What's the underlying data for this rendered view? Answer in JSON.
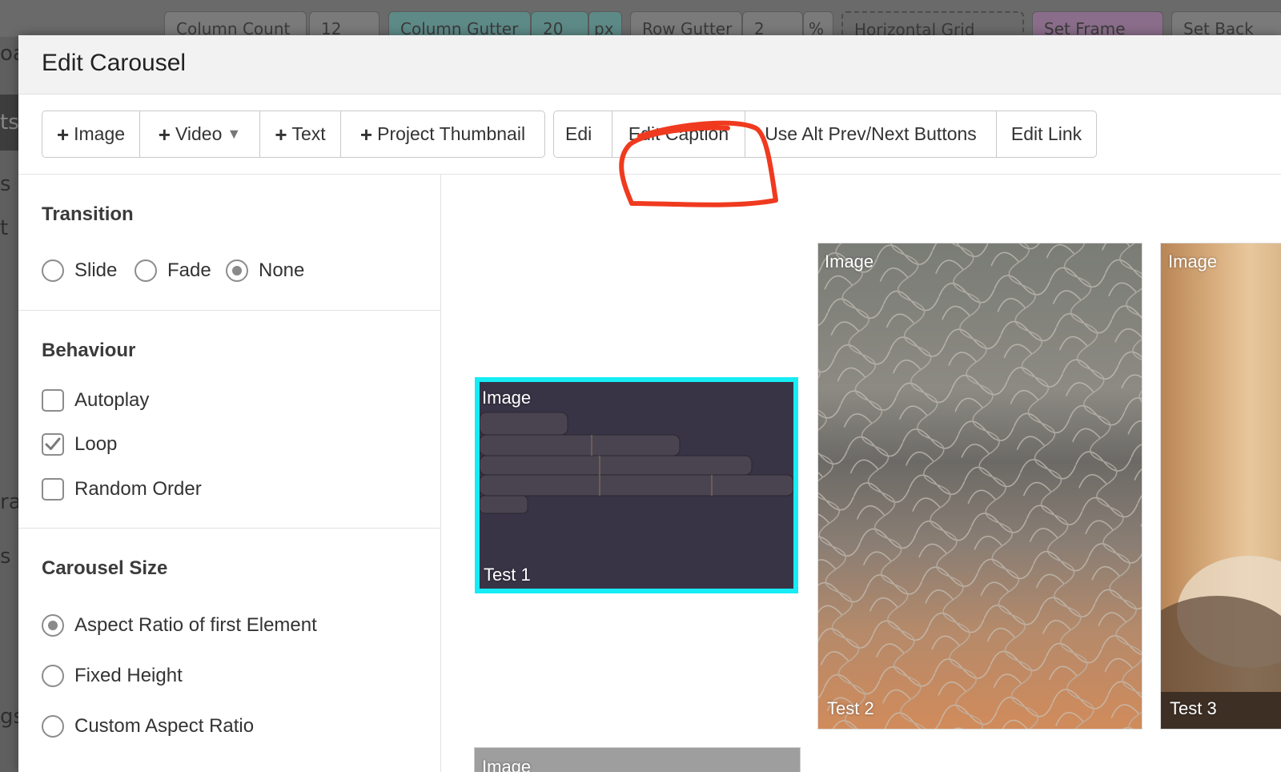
{
  "background": {
    "controls": [
      "Column Count",
      "12",
      "Column Gutter",
      "20",
      "px",
      "Row Gutter",
      "2",
      "%",
      "Horizontal Grid",
      "Set Frame",
      "Set Back"
    ],
    "left_fragments": [
      "oa",
      "ts",
      "s",
      "t",
      "ra",
      "s",
      "gs"
    ]
  },
  "modal": {
    "title": "Edit Carousel",
    "toolbar": {
      "add_group": [
        {
          "name": "add-image",
          "label": "Image",
          "plus": "+"
        },
        {
          "name": "add-video",
          "label": "Video",
          "plus": "+",
          "caret": "▼"
        },
        {
          "name": "add-text",
          "label": "Text",
          "plus": "+"
        },
        {
          "name": "add-project-thumbnail",
          "label": "Project Thumbnail",
          "plus": "+"
        }
      ],
      "edit_group": [
        {
          "name": "edit-truncated",
          "label": "Edi"
        },
        {
          "name": "edit-caption",
          "label": "Edit Caption"
        },
        {
          "name": "use-alt-prev-next",
          "label": "Use Alt Prev/Next Buttons"
        },
        {
          "name": "edit-link",
          "label": "Edit Link"
        }
      ]
    },
    "annotation_color": "#f03a1f",
    "selected_color": "#16ecf4",
    "left": {
      "transition": {
        "title": "Transition",
        "options": [
          {
            "label": "Slide",
            "checked": false
          },
          {
            "label": "Fade",
            "checked": false
          },
          {
            "label": "None",
            "checked": true
          }
        ]
      },
      "behaviour": {
        "title": "Behaviour",
        "options": [
          {
            "label": "Autoplay",
            "checked": false
          },
          {
            "label": "Loop",
            "checked": true
          },
          {
            "label": "Random Order",
            "checked": false
          }
        ]
      },
      "size": {
        "title": "Carousel Size",
        "options": [
          {
            "label": "Aspect Ratio of first Element",
            "checked": true
          },
          {
            "label": "Fixed Height",
            "checked": false
          },
          {
            "label": "Custom Aspect Ratio",
            "checked": false
          }
        ]
      }
    },
    "slides": [
      {
        "label": "Image",
        "caption": "Test 1",
        "selected": true
      },
      {
        "label": "Image",
        "caption": "Test 2",
        "selected": false
      },
      {
        "label": "Image",
        "caption": "Test 3",
        "selected": false
      },
      {
        "label": "Image",
        "caption": "",
        "selected": false
      }
    ]
  }
}
